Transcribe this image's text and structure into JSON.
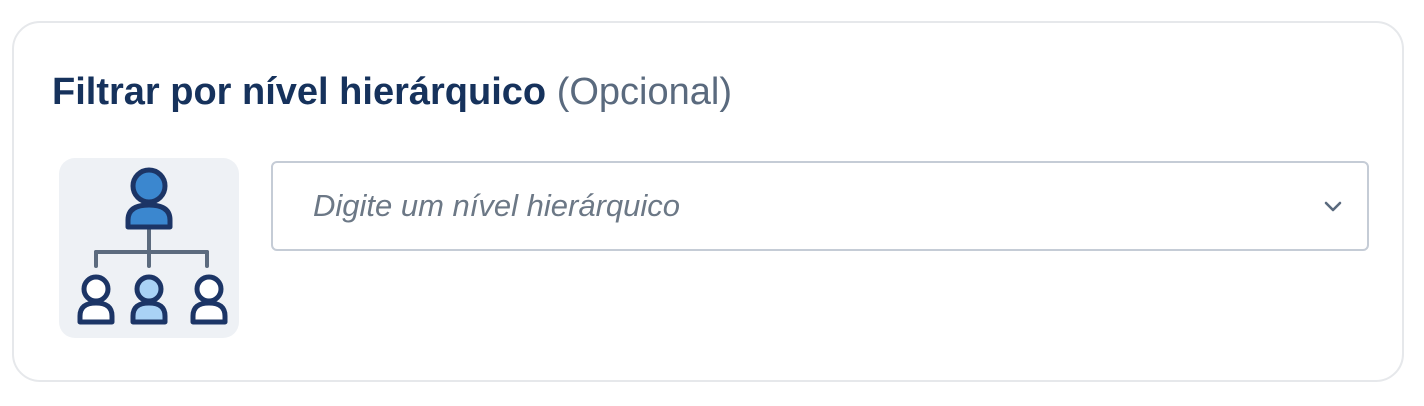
{
  "filter": {
    "title": "Filtrar por nível hierárquico",
    "optional_label": "(Opcional)",
    "input": {
      "placeholder": "Digite um nível hierárquico",
      "value": ""
    }
  },
  "icons": {
    "illustration": "org-hierarchy-icon",
    "dropdown": "chevron-down-icon"
  },
  "colors": {
    "title": "#16325c",
    "optional": "#5a6a7e",
    "icon_stroke": "#1c3566",
    "icon_fill_primary": "#3b87cf",
    "icon_fill_secondary": "#a9d2f5",
    "illustration_bg": "#eef1f5",
    "input_border": "#c5ccd6"
  }
}
